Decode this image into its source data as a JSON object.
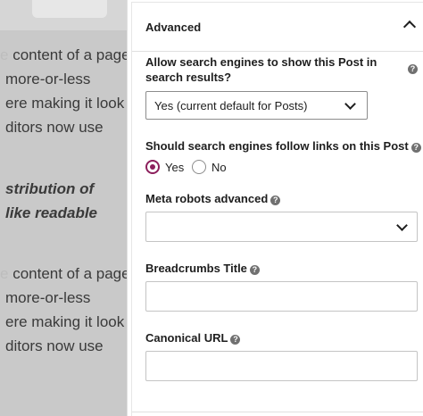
{
  "background": {
    "lines": [
      {
        "text": "content of a page",
        "prefix": "e "
      },
      {
        "text": "more-or-less",
        "prefix": ""
      },
      {
        "text": "ere making it look",
        "prefix": ""
      },
      {
        "text": "ditors now use",
        "prefix": ""
      },
      {
        "text": "stribution of",
        "prefix": ""
      },
      {
        "text": "like readable",
        "prefix": ""
      },
      {
        "text": "content of a page",
        "prefix": "e "
      },
      {
        "text": "more-or-less",
        "prefix": ""
      },
      {
        "text": "ere making it look",
        "prefix": ""
      },
      {
        "text": "ditors now use",
        "prefix": ""
      }
    ]
  },
  "panel": {
    "section_title": "Advanced",
    "index_question": "Allow search engines to show this Post in search results?",
    "index_select_value": "Yes (current default for Posts)",
    "follow_question": "Should search engines follow links on this Post",
    "radio_yes": "Yes",
    "radio_no": "No",
    "meta_robots_label": "Meta robots advanced",
    "breadcrumbs_label": "Breadcrumbs Title",
    "canonical_label": "Canonical URL",
    "help_glyph": "?"
  },
  "colors": {
    "accent": "#8c1f5c"
  }
}
